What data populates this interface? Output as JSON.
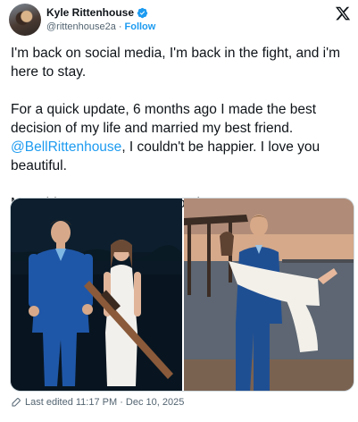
{
  "author": {
    "name": "Kyle Rittenhouse",
    "handle": "@rittenhouse2a",
    "separator": "·",
    "follow_label": "Follow"
  },
  "tweet": {
    "line1": "I'm back on social media, I'm back in the fight, and i'm here to stay.",
    "line2_pre": "For a quick update, 6 months ago I made the best decision of my life and married my best friend.",
    "mention": "@BellRittenhouse",
    "line2_post": ", I couldn't be happier. I love you beautiful.",
    "line3": "More big announcements coming soon..."
  },
  "footer": {
    "edited_label": "Last edited 11:17 PM · Dec 10, 2025"
  },
  "icons": {
    "verified": "verified-badge-icon",
    "platform": "x-logo-icon",
    "edit": "pencil-icon"
  },
  "colors": {
    "accent": "#1d9bf0",
    "secondary_text": "#536471",
    "text": "#0f1419"
  }
}
